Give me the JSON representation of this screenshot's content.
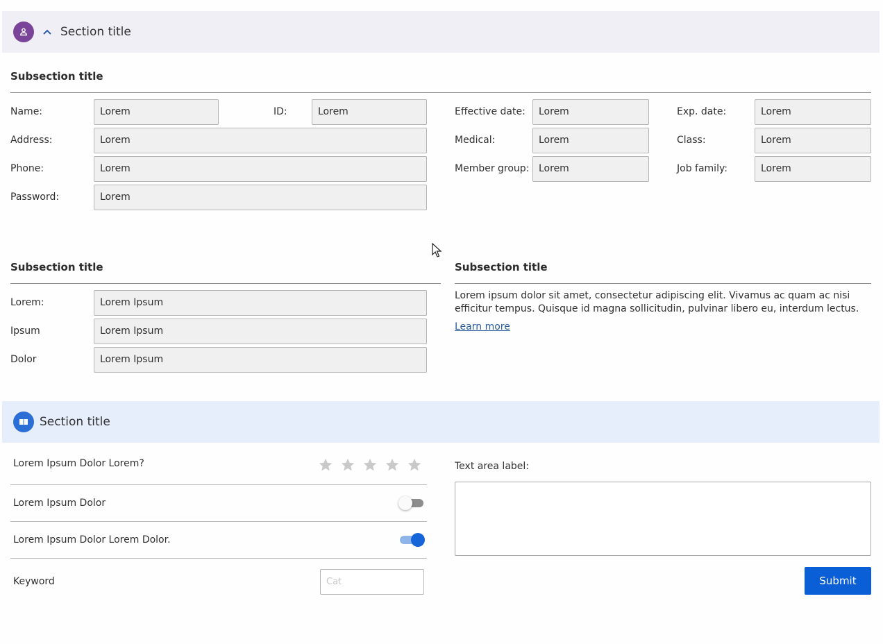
{
  "section1": {
    "title": "Section title",
    "icon": "person-icon",
    "chevron": "chevron-up-icon"
  },
  "subsection1": {
    "title": "Subsection title",
    "fields": {
      "name": {
        "label": "Name:",
        "value": "Lorem"
      },
      "id": {
        "label": "ID:",
        "value": "Lorem"
      },
      "address": {
        "label": "Address:",
        "value": "Lorem"
      },
      "phone": {
        "label": "Phone:",
        "value": "Lorem"
      },
      "password": {
        "label": "Password:",
        "value": "Lorem"
      },
      "effective_date": {
        "label": "Effective date:",
        "value": "Lorem"
      },
      "medical": {
        "label": "Medical:",
        "value": "Lorem"
      },
      "member_group": {
        "label": "Member group:",
        "value": "Lorem"
      },
      "exp_date": {
        "label": "Exp. date:",
        "value": "Lorem"
      },
      "class": {
        "label": "Class:",
        "value": "Lorem"
      },
      "job_family": {
        "label": "Job family:",
        "value": "Lorem"
      }
    }
  },
  "subsection2": {
    "title": "Subsection title",
    "fields": {
      "lorem": {
        "label": "Lorem:",
        "value": "Lorem Ipsum"
      },
      "ipsum": {
        "label": "Ipsum",
        "value": "Lorem Ipsum"
      },
      "dolor": {
        "label": "Dolor",
        "value": "Lorem Ipsum"
      }
    }
  },
  "subsection3": {
    "title": "Subsection title",
    "paragraph": "Lorem ipsum dolor sit amet, consectetur adipiscing elit. Vivamus ac quam ac nisi efficitur tempus. Quisque id magna sollicitudin, pulvinar libero eu, interdum lectus.",
    "link": "Learn more"
  },
  "section2": {
    "title": "Section title",
    "icon": "book-icon",
    "rating": {
      "label": "Lorem Ipsum Dolor Lorem?",
      "max": 5,
      "value": 0
    },
    "toggle1": {
      "label": "Lorem Ipsum Dolor",
      "on": false
    },
    "toggle2": {
      "label": "Lorem Ipsum Dolor Lorem Dolor.",
      "on": true
    },
    "keyword": {
      "label": "Keyword",
      "placeholder": "Cat"
    },
    "textarea": {
      "label": "Text area label:"
    },
    "submit_label": "Submit"
  },
  "colors": {
    "accent": "#0a5fd6",
    "section1_bg": "#f1eff6",
    "section2_bg": "#e6eefc",
    "section1_icon": "#7a4498"
  }
}
